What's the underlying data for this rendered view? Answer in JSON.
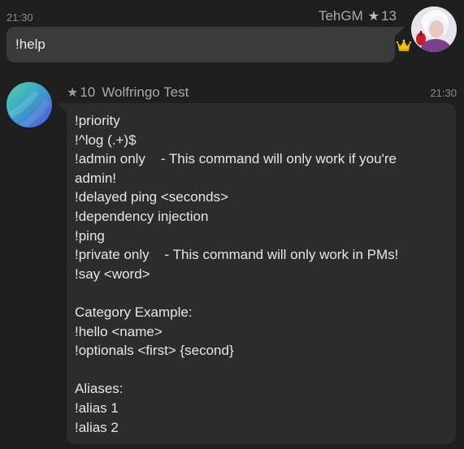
{
  "colors": {
    "background": "#1e1e1e",
    "outgoing_bubble": "#3a3a3a",
    "incoming_bubble": "#2c2c2c",
    "meta_text": "#8c8c8c"
  },
  "outgoing": {
    "time": "21:30",
    "sender_name": "TehGM",
    "sender_level": "13",
    "text": "!help",
    "badge_icon": "crown-icon"
  },
  "incoming": {
    "sender_level": "10",
    "sender_name": "Wolfringo Test",
    "time": "21:30",
    "lines": [
      "!priority",
      "!^log (.+)$",
      "!admin only    - This command will only work if you're",
      "admin!",
      "!delayed ping <seconds>",
      "!dependency injection",
      "!ping",
      "!private only    - This command will only work in PMs!",
      "!say <word>",
      "",
      "Category Example:",
      "!hello <name>",
      "!optionals <first> {second}",
      "",
      "Aliases:",
      "!alias 1",
      "!alias 2"
    ]
  }
}
